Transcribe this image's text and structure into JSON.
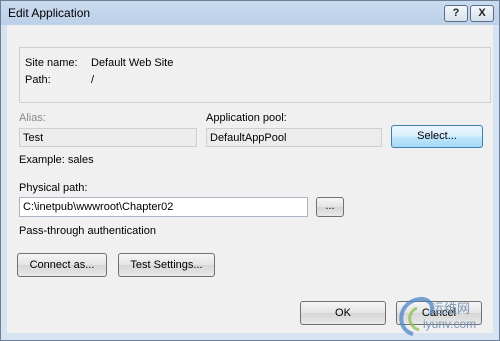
{
  "window": {
    "title": "Edit Application",
    "help_glyph": "?",
    "close_glyph": "X"
  },
  "info": {
    "site_name_label": "Site name:",
    "site_name_value": "Default Web Site",
    "path_label": "Path:",
    "path_value": "/"
  },
  "alias": {
    "label": "Alias:",
    "value": "Test",
    "example": "Example: sales"
  },
  "app_pool": {
    "label": "Application pool:",
    "value": "DefaultAppPool",
    "select_button": "Select..."
  },
  "physical_path": {
    "label": "Physical path:",
    "value": "C:\\inetpub\\wwwroot\\Chapter02",
    "browse_button": "..."
  },
  "auth": {
    "label": "Pass-through authentication",
    "connect_as_button": "Connect as...",
    "test_settings_button": "Test Settings..."
  },
  "footer": {
    "ok_button": "OK",
    "cancel_button": "Cancel"
  },
  "watermark": {
    "line1": "运维网",
    "line2": "iyunv.com"
  }
}
